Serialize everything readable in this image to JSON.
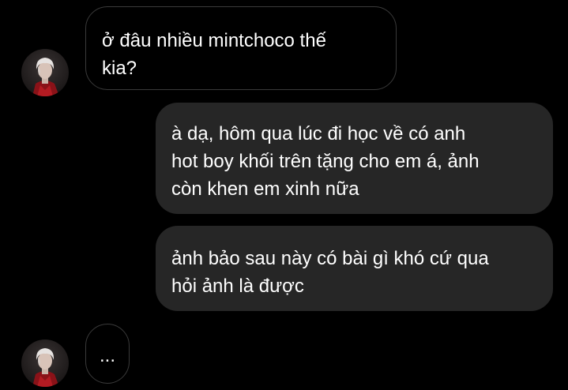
{
  "conversation": {
    "messages": [
      {
        "sender": "them",
        "text": "ở đâu nhiều mintchoco thế\nkia?"
      },
      {
        "sender": "me",
        "text": "à dạ, hôm qua lúc đi học về có anh\nhot boy khối trên tặng cho em á, ảnh\ncòn khen em xinh nữa"
      },
      {
        "sender": "me",
        "text": "ảnh bảo sau này có bài gì khó cứ qua\nhỏi ảnh là được"
      },
      {
        "sender": "them",
        "text": "..."
      }
    ],
    "contact_avatar_icon": "profile-photo"
  },
  "colors": {
    "background": "#000000",
    "incoming_bubble_border": "#3a3a3a",
    "outgoing_bubble": "#262626",
    "text": "#ffffff"
  }
}
